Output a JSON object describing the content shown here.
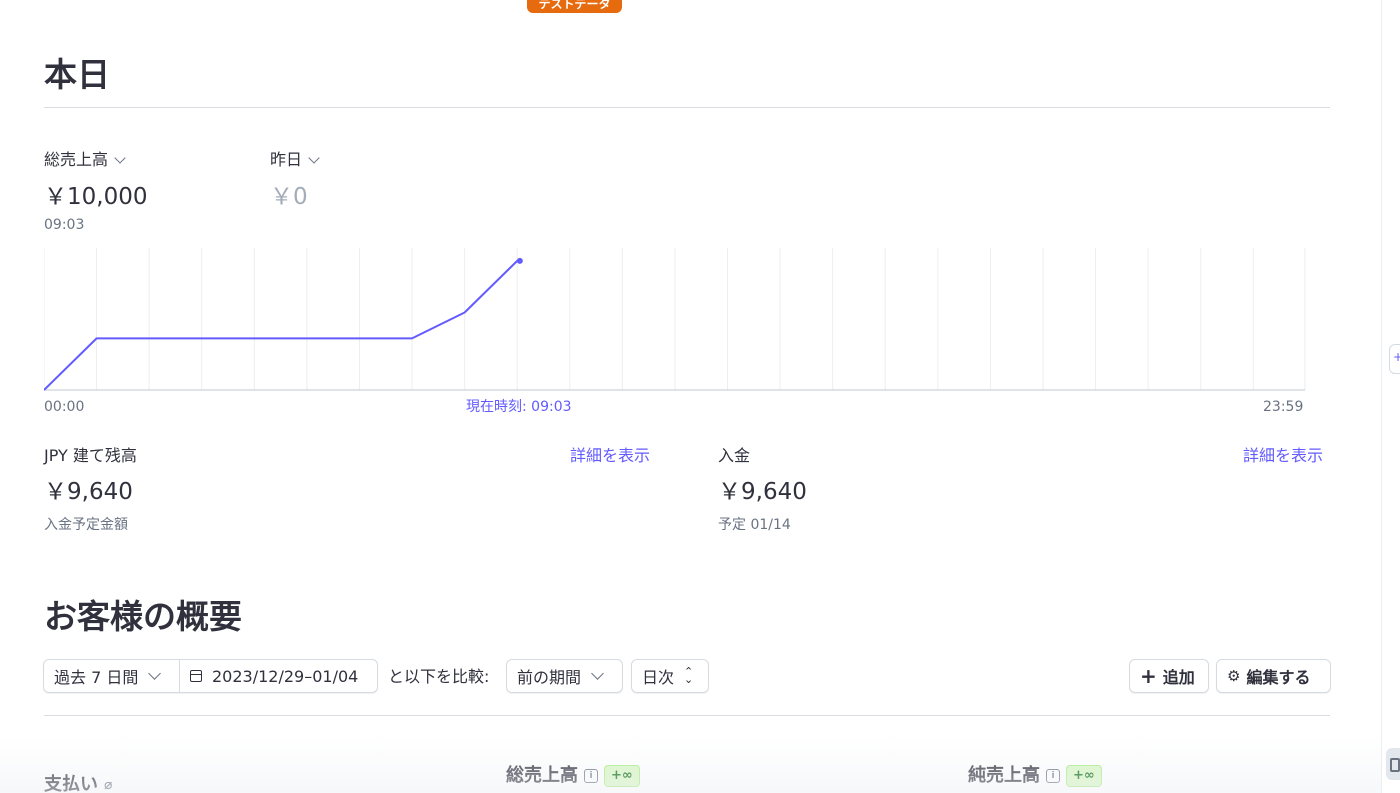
{
  "badge": {
    "test_data": "テストデータ"
  },
  "today": {
    "title": "本日",
    "primary_metric": {
      "label": "総売上高",
      "value": "￥10,000",
      "time": "09:03"
    },
    "compare_metric": {
      "label": "昨日",
      "value": "￥0"
    },
    "axis": {
      "start": "00:00",
      "now": "現在時刻: 09:03",
      "end": "23:59"
    }
  },
  "chart_data": {
    "type": "line",
    "x": [
      "00:00",
      "01:00",
      "02:00",
      "03:00",
      "04:00",
      "05:00",
      "06:00",
      "07:00",
      "08:00",
      "09:00",
      "09:03"
    ],
    "series": [
      {
        "values": [
          0,
          4000,
          4000,
          4000,
          4000,
          4000,
          4000,
          4000,
          6000,
          10000,
          10000
        ]
      }
    ],
    "xlim": [
      "00:00",
      "23:59"
    ],
    "ylim": [
      0,
      11000
    ],
    "grid": "vertical",
    "colors": {
      "line": "#635bff",
      "grid": "#ebeef1",
      "axis": "#c0c8d2"
    }
  },
  "balance": {
    "title": "JPY 建て残高",
    "link": "詳細を表示",
    "value": "￥9,640",
    "sub": "入金予定金額"
  },
  "payout": {
    "title": "入金",
    "link": "詳細を表示",
    "value": "￥9,640",
    "sub": "予定 01/14"
  },
  "overview": {
    "title": "お客様の概要",
    "range_label": "過去 7 日間",
    "date_range": "2023/12/29–01/04",
    "compare_text": "と以下を比較:",
    "compare_value": "前の期間",
    "interval": "日次",
    "add_label": "追加",
    "edit_label": "編集する",
    "metrics": [
      {
        "label": "支払い"
      },
      {
        "label": "総売上高",
        "badge": "+∞"
      },
      {
        "label": "純売上高",
        "badge": "+∞"
      }
    ]
  },
  "colors": {
    "accent": "#635bff",
    "badge_orange": "#e66a0e",
    "positive_bg": "#d7f7c2",
    "positive_text": "#05690d"
  }
}
